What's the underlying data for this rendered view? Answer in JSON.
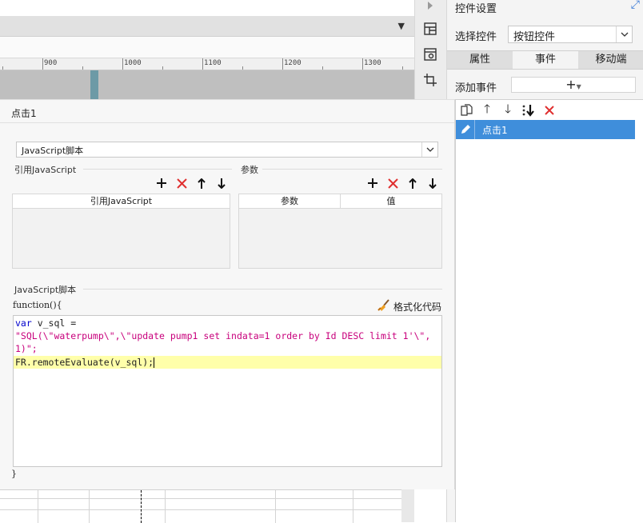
{
  "ruler": {
    "ticks": [
      "900",
      "1000",
      "1100",
      "1200",
      "1300"
    ]
  },
  "icons": {
    "strip": [
      "arrow-right-icon",
      "layout-grid-icon",
      "widget-settings-icon",
      "crop-icon"
    ],
    "panel_expand": "expand-arrow-icon"
  },
  "panel": {
    "title": "控件设置",
    "select_label": "选择控件",
    "select_value": "按钮控件",
    "tabs": [
      "属性",
      "事件",
      "移动端"
    ],
    "active_tab": "事件",
    "add_event_label": "添加事件",
    "add_event_button": "+",
    "events": [
      {
        "label": "点击1"
      }
    ]
  },
  "dialog": {
    "title": "点击1",
    "script_type": "JavaScript脚本",
    "ref_section_label": "引用JavaScript",
    "ref_column": "引用JavaScript",
    "param_section_label": "参数",
    "param_columns": [
      "参数",
      "值"
    ],
    "script_section_label": "JavaScript脚本",
    "function_open": "function(){",
    "format_button": "格式化代码",
    "function_close": "}",
    "code": {
      "line1_kw": "var",
      "line1_rest": " v_sql =",
      "line2": "\"SQL(\\\"waterpump\\\",\\\"update pump1 set indata=1 order by Id DESC limit 1'\\\",",
      "line3": "1)\";",
      "line4": "FR.remoteEvaluate(v_sql);"
    }
  },
  "colors": {
    "accent": "#3f8edb",
    "highlight": "#ffffaa",
    "delete_red": "#e03030",
    "keyword_blue": "#0000cc",
    "string_magenta": "#c8007c"
  }
}
